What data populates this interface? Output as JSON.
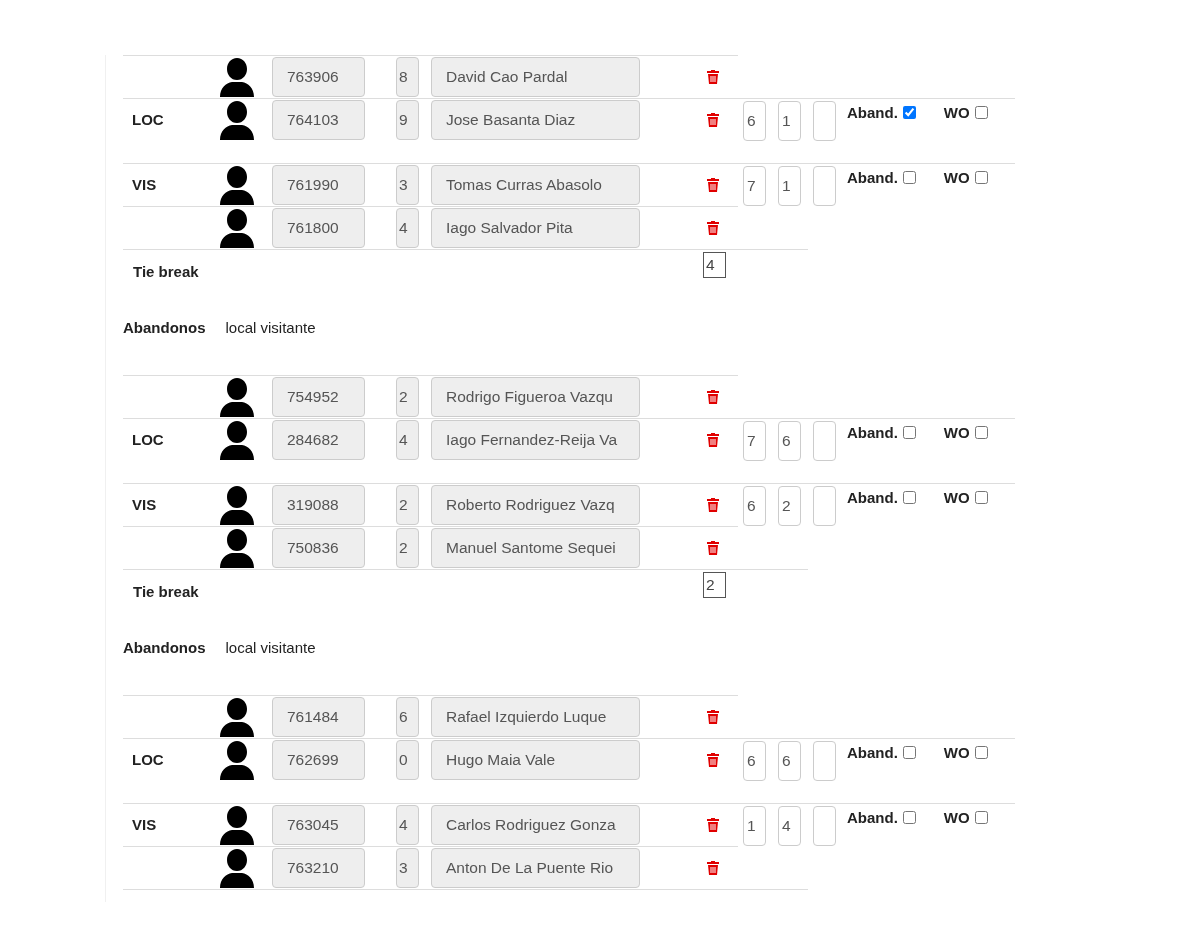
{
  "matches": [
    {
      "teams": [
        {
          "kind": "local",
          "label": "LOC",
          "players": [
            {
              "id": "763906",
              "number": "8",
              "name": "David Cao Pardal"
            },
            {
              "id": "764103",
              "number": "9",
              "name": "Jose Basanta Diaz"
            }
          ],
          "scores": [
            "6",
            "1"
          ],
          "aband": {
            "label": "Aband.",
            "checked": true
          },
          "wo": {
            "label": "WO",
            "checked": false
          }
        },
        {
          "kind": "visitor",
          "label": "VIS",
          "players": [
            {
              "id": "761990",
              "number": "3",
              "name": "Tomas Curras Abasolo"
            },
            {
              "id": "761800",
              "number": "4",
              "name": "Iago Salvador Pita"
            }
          ],
          "scores": [
            "7",
            "1"
          ],
          "aband": {
            "label": "Aband.",
            "checked": false
          },
          "wo": {
            "label": "WO",
            "checked": false
          }
        }
      ],
      "tie_break": {
        "label": "Tie break",
        "value": "4"
      },
      "abandonos": {
        "label": "Abandonos",
        "text": "local visitante"
      }
    },
    {
      "teams": [
        {
          "kind": "local",
          "label": "LOC",
          "players": [
            {
              "id": "754952",
              "number": "2",
              "name": "Rodrigo Figueroa Vazqu"
            },
            {
              "id": "284682",
              "number": "4",
              "name": "Iago Fernandez-Reija Va"
            }
          ],
          "scores": [
            "7",
            "6"
          ],
          "aband": {
            "label": "Aband.",
            "checked": false
          },
          "wo": {
            "label": "WO",
            "checked": false
          }
        },
        {
          "kind": "visitor",
          "label": "VIS",
          "players": [
            {
              "id": "319088",
              "number": "2",
              "name": "Roberto Rodriguez Vazq"
            },
            {
              "id": "750836",
              "number": "2",
              "name": "Manuel Santome Sequei"
            }
          ],
          "scores": [
            "6",
            "2"
          ],
          "aband": {
            "label": "Aband.",
            "checked": false
          },
          "wo": {
            "label": "WO",
            "checked": false
          }
        }
      ],
      "tie_break": {
        "label": "Tie break",
        "value": "2"
      },
      "abandonos": {
        "label": "Abandonos",
        "text": "local visitante"
      }
    },
    {
      "teams": [
        {
          "kind": "local",
          "label": "LOC",
          "players": [
            {
              "id": "761484",
              "number": "6",
              "name": "Rafael Izquierdo Luque"
            },
            {
              "id": "762699",
              "number": "0",
              "name": "Hugo Maia Vale"
            }
          ],
          "scores": [
            "6",
            "6"
          ],
          "aband": {
            "label": "Aband.",
            "checked": false
          },
          "wo": {
            "label": "WO",
            "checked": false
          }
        },
        {
          "kind": "visitor",
          "label": "VIS",
          "players": [
            {
              "id": "763045",
              "number": "4",
              "name": "Carlos Rodriguez Gonza"
            },
            {
              "id": "763210",
              "number": "3",
              "name": "Anton De La Puente Rio"
            }
          ],
          "scores": [
            "1",
            "4"
          ],
          "aband": {
            "label": "Aband.",
            "checked": false
          },
          "wo": {
            "label": "WO",
            "checked": false
          }
        }
      ]
    }
  ]
}
